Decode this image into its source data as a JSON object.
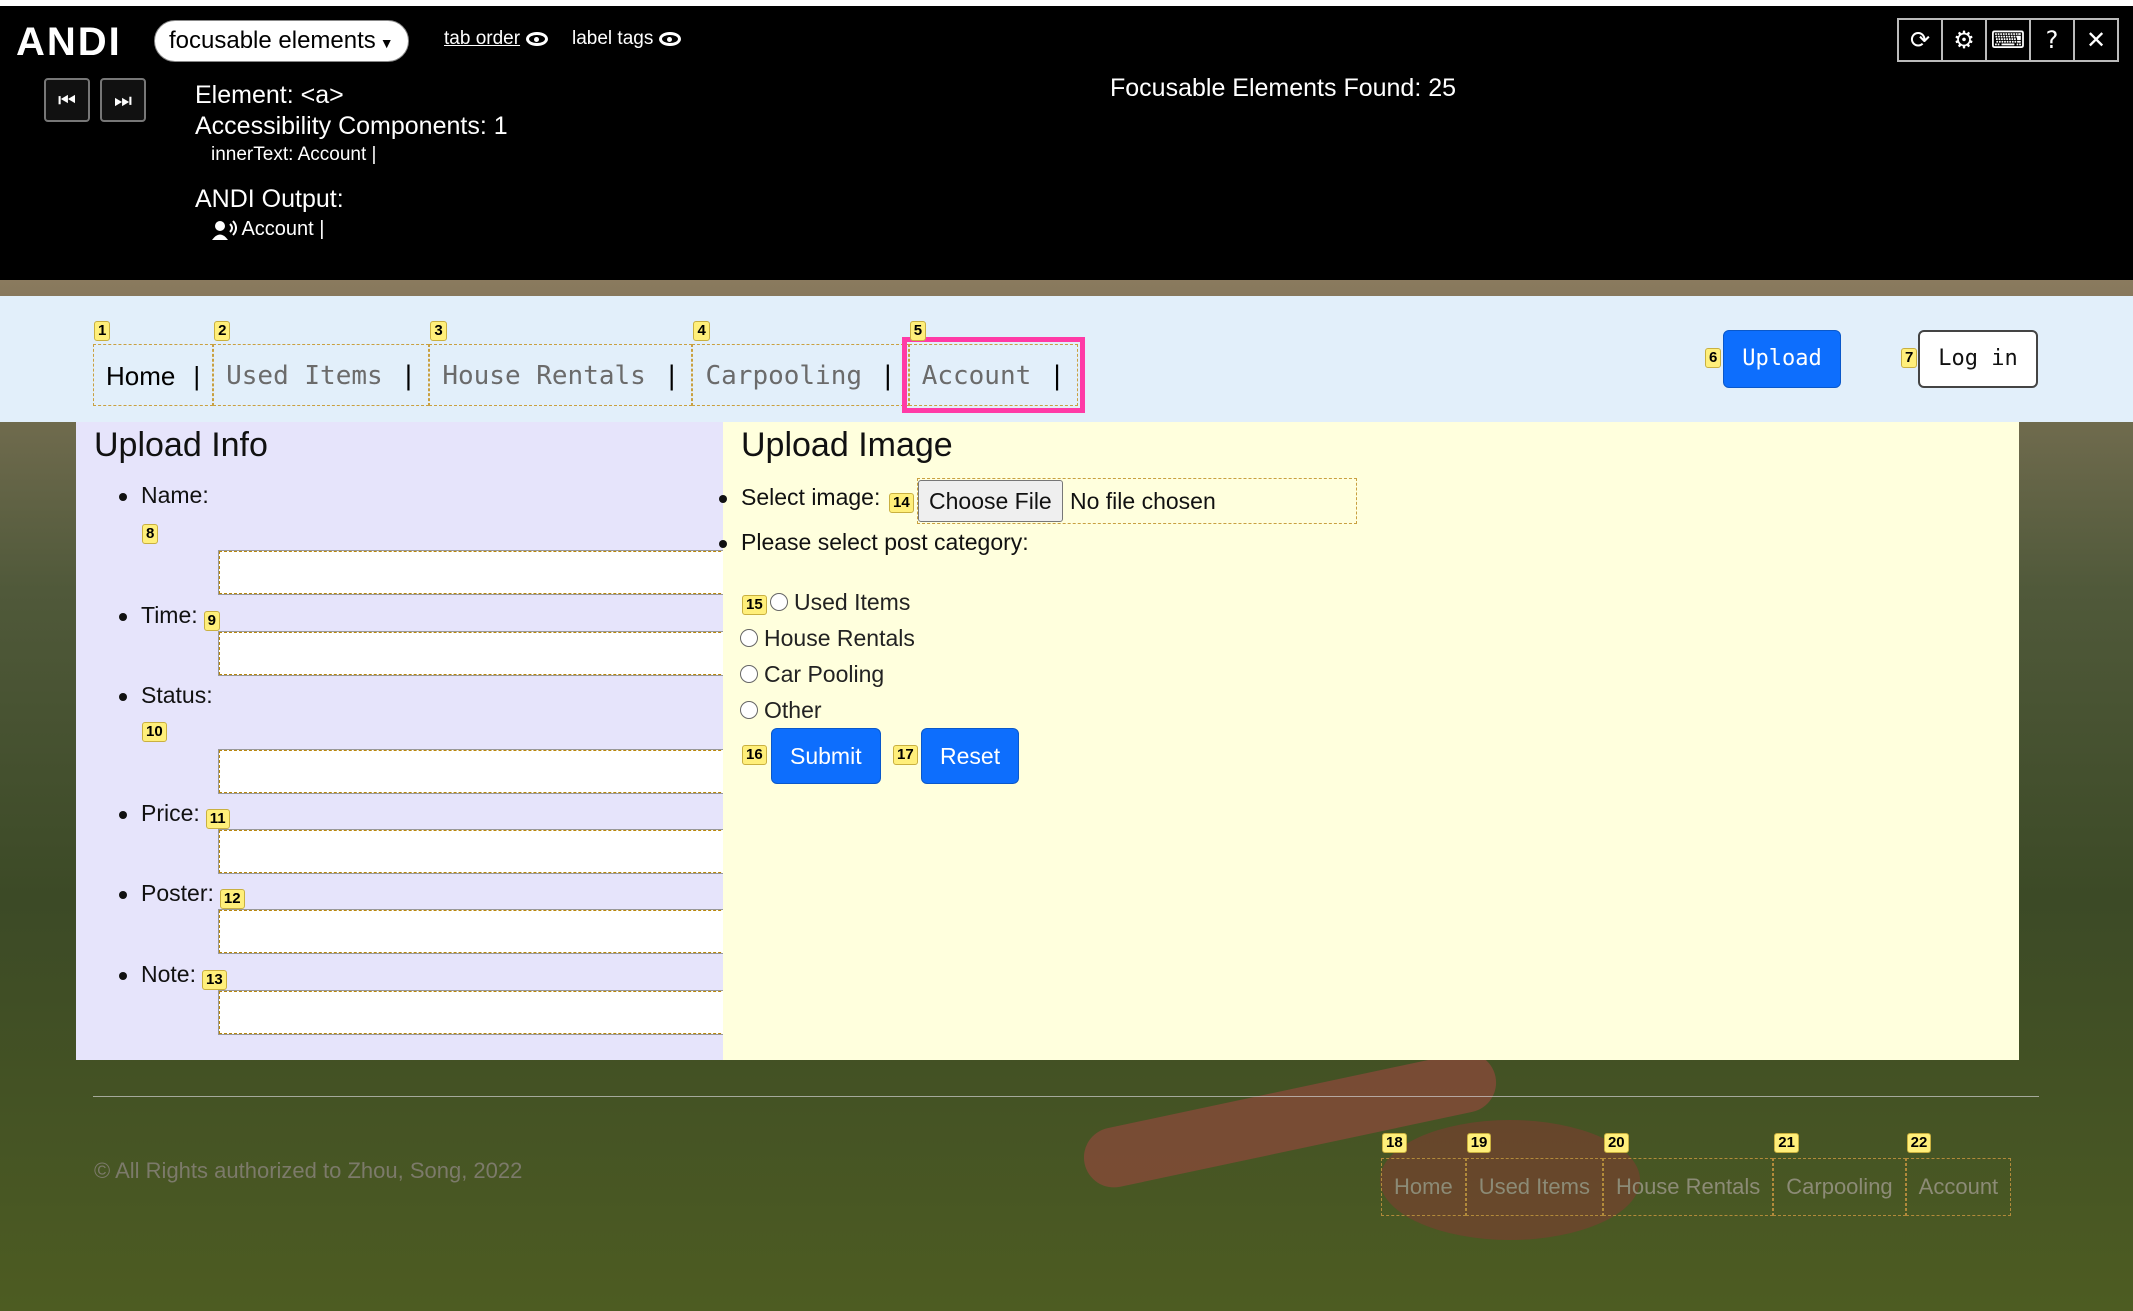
{
  "andi": {
    "logo": "ANDI",
    "module": "focusable elements",
    "tab_order": "tab order",
    "label_tags": "label tags",
    "element": "Element: <a>",
    "components": "Accessibility Components: 1",
    "inner_text": "innerText: Account |",
    "output_title": "ANDI Output:",
    "output_value": "Account |",
    "found": "Focusable Elements Found: 25",
    "icons": [
      "refresh-icon",
      "gear-icon",
      "keyboard-icon",
      "help-icon",
      "close-icon"
    ],
    "icon_glyphs": [
      "⟳",
      "⚙",
      "⌨",
      "?",
      "✕"
    ]
  },
  "nav": {
    "items": [
      {
        "badge": "1",
        "label": "Home"
      },
      {
        "badge": "2",
        "label": "Used Items"
      },
      {
        "badge": "3",
        "label": "House Rentals"
      },
      {
        "badge": "4",
        "label": "Carpooling"
      },
      {
        "badge": "5",
        "label": "Account"
      }
    ],
    "separator": "|",
    "upload_badge": "6",
    "upload": "Upload",
    "login_badge": "7",
    "login": "Log in"
  },
  "upload_info": {
    "title": "Upload Info",
    "fields": [
      {
        "label": "Name:",
        "badge": "8"
      },
      {
        "label": "Time:",
        "badge": "9"
      },
      {
        "label": "Status:",
        "badge": "10"
      },
      {
        "label": "Price:",
        "badge": "11"
      },
      {
        "label": "Poster:",
        "badge": "12"
      },
      {
        "label": "Note:",
        "badge": "13"
      }
    ]
  },
  "upload_image": {
    "title": "Upload Image",
    "select_label": "Select image:",
    "file_badge": "14",
    "choose_file": "Choose File",
    "no_file": "No file chosen",
    "category_label": "Please select post category:",
    "radio_badge": "15",
    "categories": [
      "Used Items",
      "House Rentals",
      "Car Pooling",
      "Other"
    ],
    "submit_badge": "16",
    "submit": "Submit",
    "reset_badge": "17",
    "reset": "Reset"
  },
  "footer": {
    "copyright": "© All Rights authorized to Zhou, Song, 2022",
    "links": [
      {
        "badge": "18",
        "label": "Home"
      },
      {
        "badge": "19",
        "label": "Used Items"
      },
      {
        "badge": "20",
        "label": "House Rentals"
      },
      {
        "badge": "21",
        "label": "Carpooling"
      },
      {
        "badge": "22",
        "label": "Account"
      }
    ]
  },
  "colors": {
    "accent_blue": "#0d6efd",
    "focus_highlight": "#ff3aa6",
    "badge_yellow": "#ffef7a",
    "left_panel": "#e6e4fb",
    "right_panel": "#ffffdd",
    "nav_bg": "#e2effa"
  }
}
